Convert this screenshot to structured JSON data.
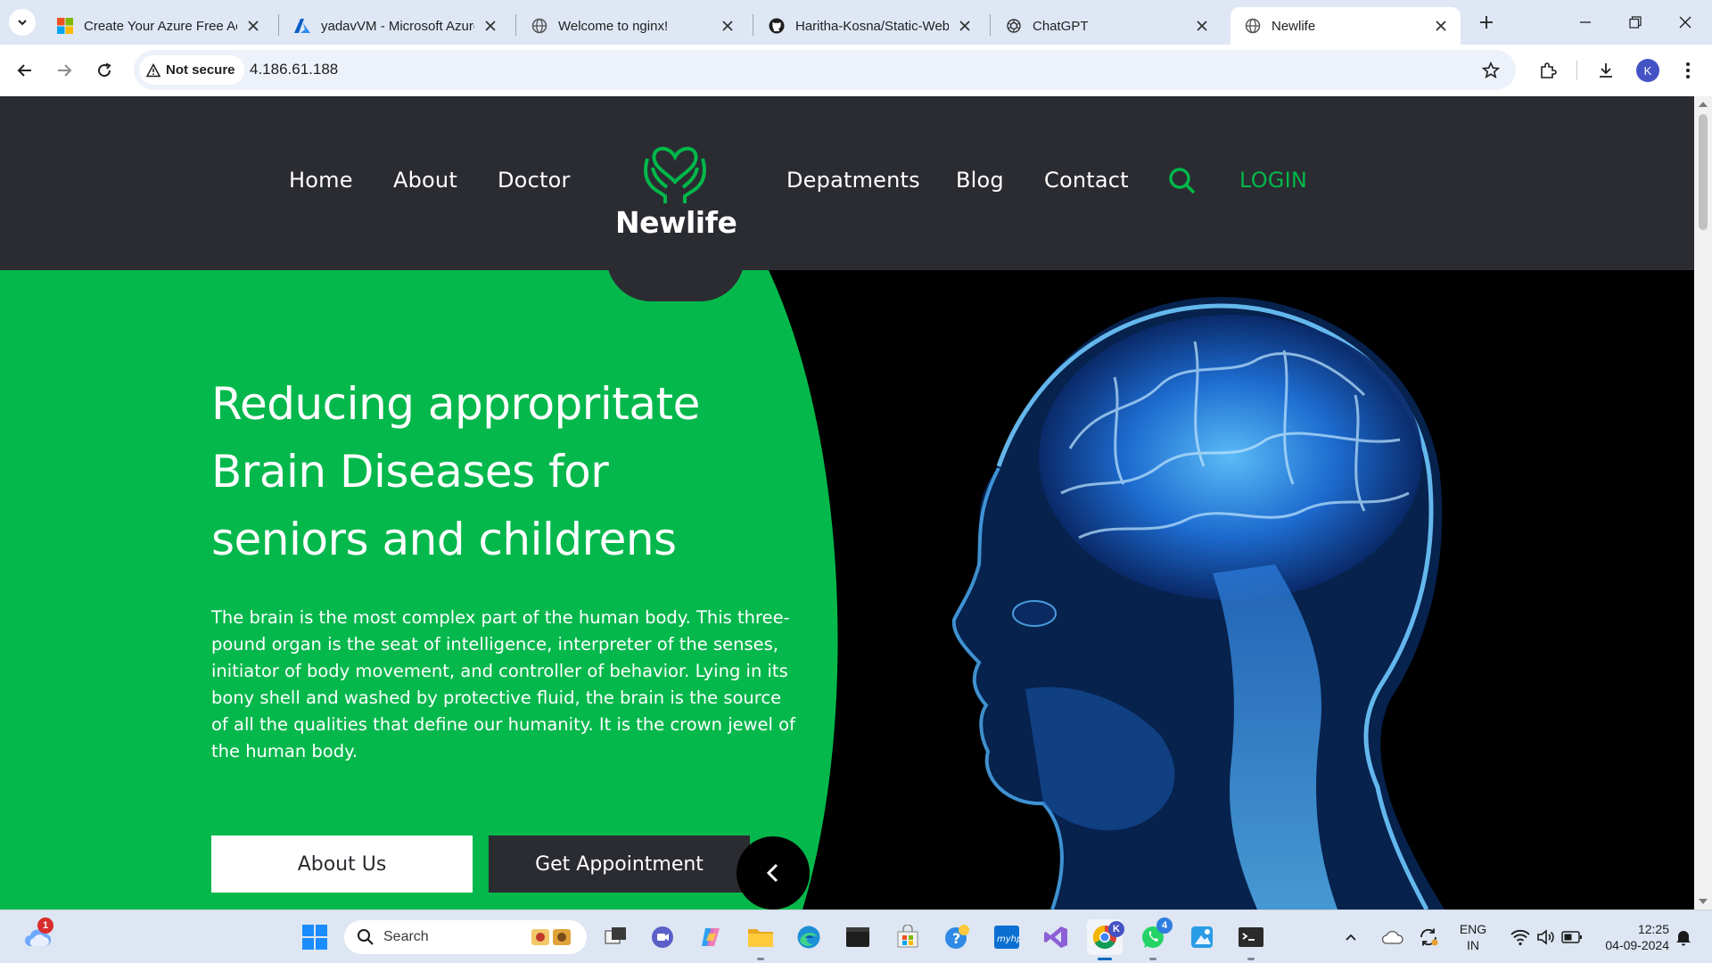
{
  "browser": {
    "tabs": [
      {
        "title": "Create Your Azure Free Acc",
        "icon": "microsoft-logo-icon",
        "active": false
      },
      {
        "title": "yadavVM - Microsoft Azure",
        "icon": "azure-logo-icon",
        "active": false
      },
      {
        "title": "Welcome to nginx!",
        "icon": "globe-icon",
        "active": false
      },
      {
        "title": "Haritha-Kosna/Static-Web",
        "icon": "github-icon",
        "active": false
      },
      {
        "title": "ChatGPT",
        "icon": "chatgpt-icon",
        "active": false
      },
      {
        "title": "Newlife",
        "icon": "globe-icon",
        "active": true
      }
    ],
    "address": {
      "security_label": "Not secure",
      "url": "4.186.61.188"
    },
    "profile_initial": "K"
  },
  "site": {
    "logo_text": "Newlife",
    "nav_left": [
      "Home",
      "About",
      "Doctor"
    ],
    "nav_right": [
      "Depatments",
      "Blog",
      "Contact"
    ],
    "login_label": "LOGIN",
    "colors": {
      "accent": "#00b84a",
      "header_bg": "#2b2c31",
      "hero_green": "#05b84c"
    }
  },
  "hero": {
    "title_lines": [
      "Reducing appropritate",
      "Brain Diseases for",
      "seniors and childrens"
    ],
    "body": "The brain is the most complex part of the human body. This three-pound organ is the seat of intelligence, interpreter of the senses, initiator of body movement, and controller of behavior. Lying in its bony shell and washed by protective fluid, the brain is the source of all the qualities that define our humanity. It is the crown jewel of the human body.",
    "btn_about": "About Us",
    "btn_appointment": "Get Appointment"
  },
  "taskbar": {
    "weather_badge": "1",
    "search_label": "Search",
    "whatsapp_badge": "4",
    "chrome_badge": "K",
    "lang_line1": "ENG",
    "lang_line2": "IN",
    "time": "12:25",
    "date": "04-09-2024"
  }
}
